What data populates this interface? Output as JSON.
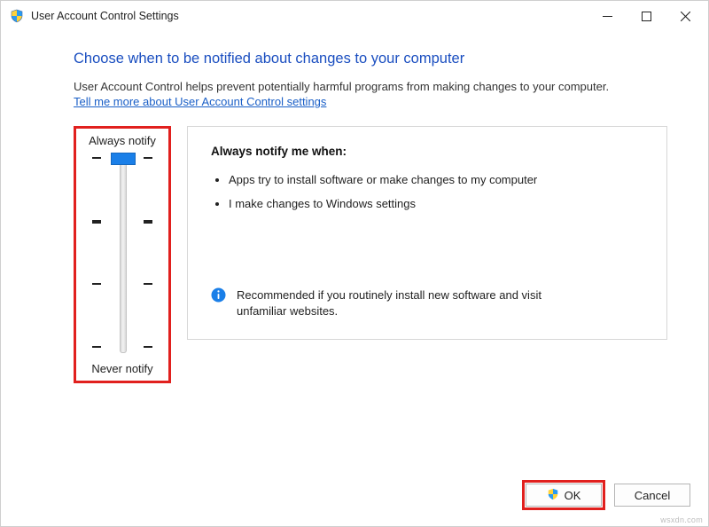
{
  "titlebar": {
    "title": "User Account Control Settings"
  },
  "heading": "Choose when to be notified about changes to your computer",
  "description": "User Account Control helps prevent potentially harmful programs from making changes to your computer.",
  "link": "Tell me more about User Account Control settings",
  "slider": {
    "top_label": "Always notify",
    "bottom_label": "Never notify",
    "levels": 4,
    "current_level": 0
  },
  "info": {
    "heading": "Always notify me when:",
    "bullets": [
      "Apps try to install software or make changes to my computer",
      "I make changes to Windows settings"
    ],
    "recommend": "Recommended if you routinely install new software and visit unfamiliar websites."
  },
  "buttons": {
    "ok": "OK",
    "cancel": "Cancel"
  },
  "watermark": "wsxdn.com"
}
